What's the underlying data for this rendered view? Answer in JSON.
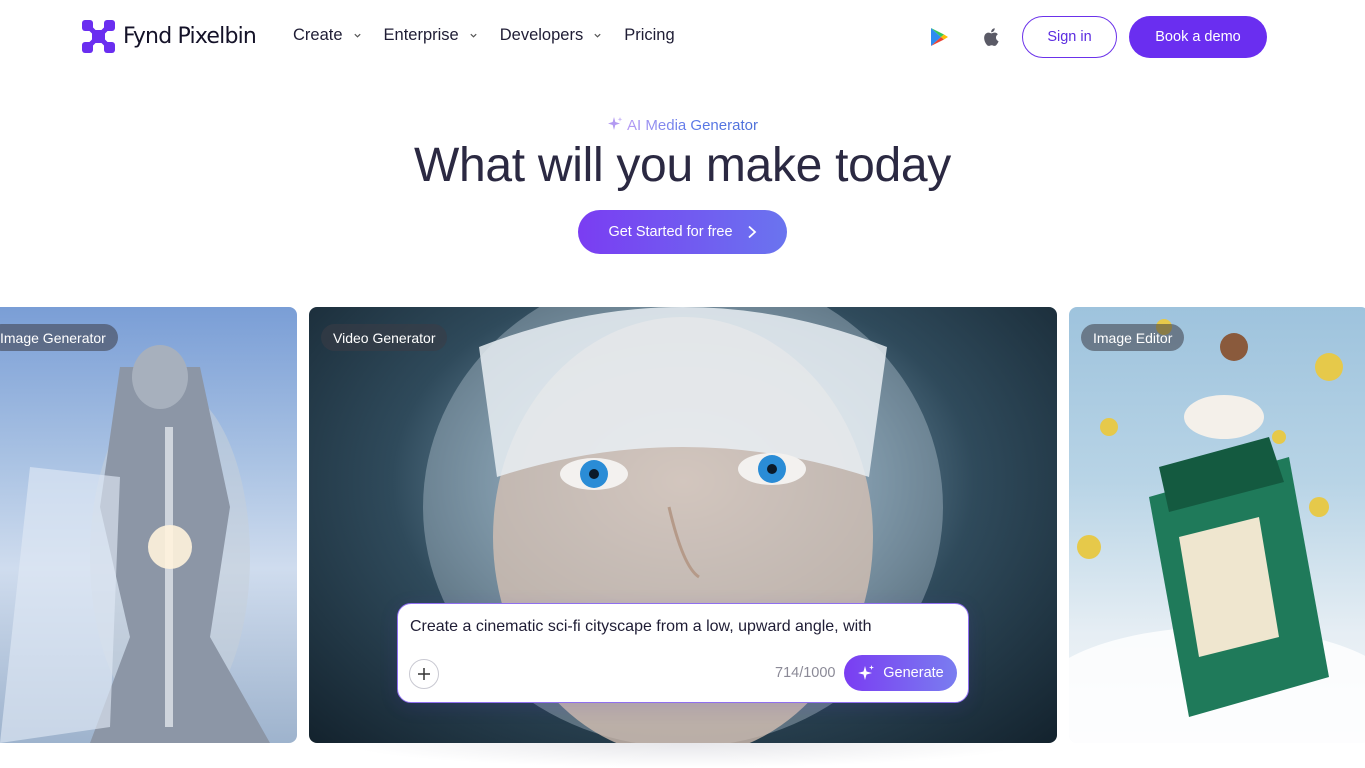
{
  "header": {
    "brand": "Fynd Pixelbin",
    "nav": [
      {
        "label": "Create",
        "has_dropdown": true
      },
      {
        "label": "Enterprise",
        "has_dropdown": true
      },
      {
        "label": "Developers",
        "has_dropdown": true
      },
      {
        "label": "Pricing",
        "has_dropdown": false
      }
    ],
    "store_icons": [
      "google-play-icon",
      "apple-icon"
    ],
    "signin_label": "Sign in",
    "demo_label": "Book a demo"
  },
  "hero": {
    "eyebrow": "AI Media Generator",
    "title": "What will you make today",
    "cta_label": "Get Started for free"
  },
  "cards": [
    {
      "tag": "Image Generator"
    },
    {
      "tag": "Video Generator"
    },
    {
      "tag": "Image Editor"
    }
  ],
  "prompt": {
    "text": "Create a cinematic sci-fi cityscape from a low, upward angle, with",
    "count": "714/1000",
    "generate_label": "Generate"
  },
  "colors": {
    "brand": "#6a2ef0",
    "text": "#1f1d35"
  }
}
